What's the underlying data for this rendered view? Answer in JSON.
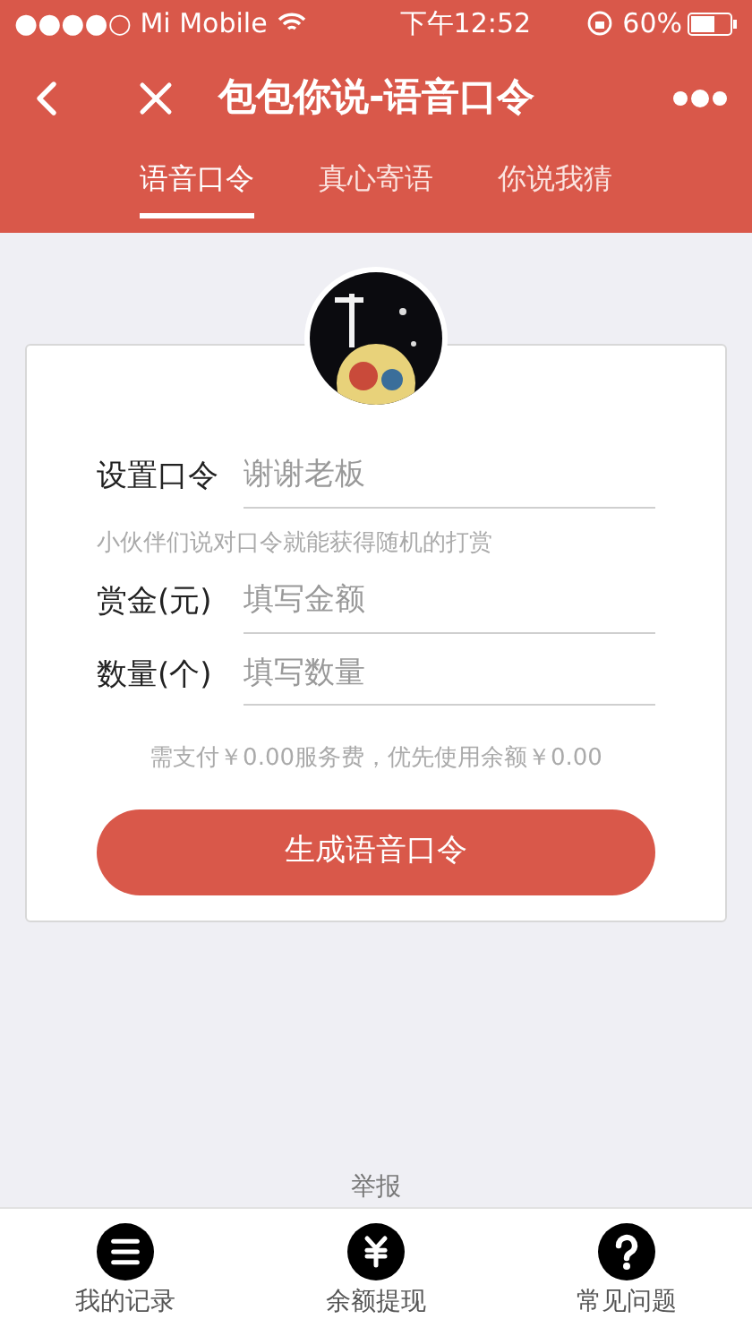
{
  "status_bar": {
    "carrier": "●●●●○ Mi Mobile",
    "time": "下午12:52",
    "battery": "60%"
  },
  "nav": {
    "title": "包包你说-语音口令"
  },
  "tabs": [
    {
      "label": "语音口令",
      "selected": true
    },
    {
      "label": "真心寄语",
      "selected": false
    },
    {
      "label": "你说我猜",
      "selected": false
    }
  ],
  "form": {
    "fields": [
      {
        "label": "设置口令",
        "placeholder": "谢谢老板",
        "hint": "小伙伴们说对口令就能获得随机的打赏"
      },
      {
        "label": "赏金(元)",
        "placeholder": "填写金额"
      },
      {
        "label": "数量(个)",
        "placeholder": "填写数量"
      }
    ],
    "fee_note": "需支付￥0.00服务费，优先使用余额￥0.00",
    "submit": "生成语音口令"
  },
  "report": "举报",
  "bottom_nav": [
    {
      "kind": "list",
      "label": "我的记录"
    },
    {
      "kind": "yen",
      "label": "余额提现"
    },
    {
      "kind": "help",
      "label": "常见问题"
    }
  ]
}
